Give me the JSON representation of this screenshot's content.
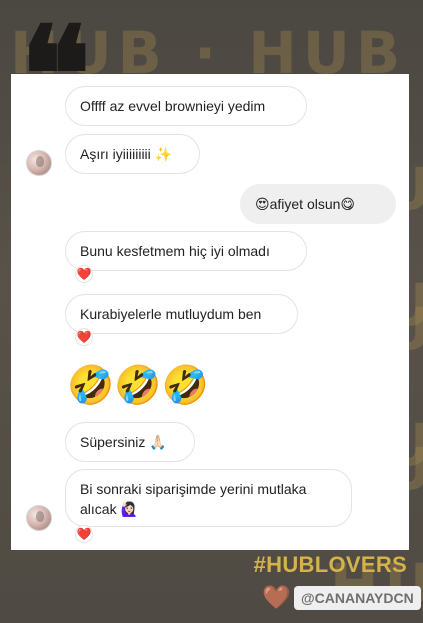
{
  "story": {
    "watermark_text": "HUB · HUB",
    "hashtag": "#HUBLOVERS",
    "mention": "@CANANAYDCN",
    "quote_mark": "❝",
    "brand_color": "#d6b24a",
    "background_color": "#524c45"
  },
  "messages": [
    {
      "text": "Offff az evvel brownieyi yedim",
      "sender": "other"
    },
    {
      "text": "Aşırı iyiiiiiiiii ✨",
      "sender": "other"
    },
    {
      "text": "😍afiyet olsun😋",
      "sender": "me"
    },
    {
      "text": "Bunu kesfetmem hiç iyi olmadı",
      "sender": "other",
      "reaction": "❤️"
    },
    {
      "text": "Kurabiyelerle mutluydum ben",
      "sender": "other",
      "reaction": "❤️"
    },
    {
      "text": "🤣🤣🤣",
      "sender": "other"
    },
    {
      "text": "Süpersiniz 🙏🏻",
      "sender": "other"
    },
    {
      "text": "Bi sonraki siparişimde yerini mutlaka alıcak 🙋🏻‍♀️",
      "sender": "other",
      "reaction": "❤️"
    }
  ],
  "footer": {
    "heart_icon": "🤎"
  }
}
